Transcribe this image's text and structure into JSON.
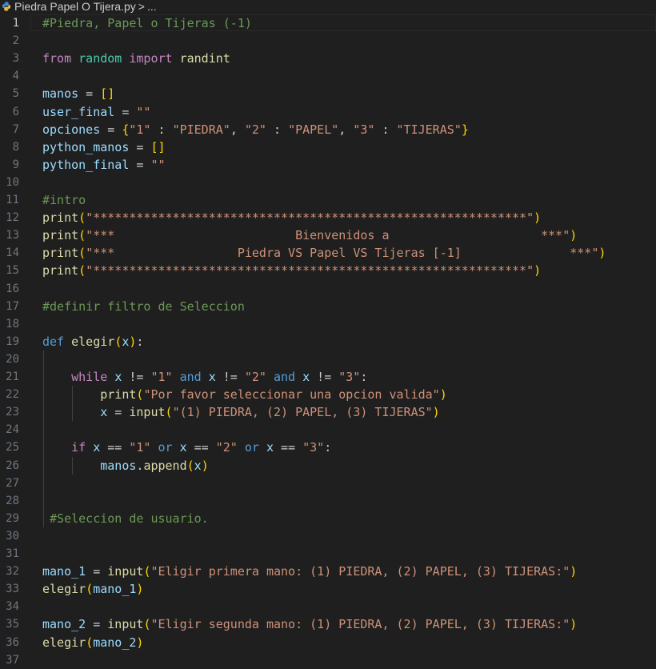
{
  "breadcrumb": {
    "file_name": "Piedra Papel O Tijera.py",
    "separator": ">",
    "ellipsis": "..."
  },
  "colors": {
    "comment": "#6a9955",
    "keyword": "#c586c0",
    "control": "#c586c0",
    "def": "#569cd6",
    "operator_word": "#569cd6",
    "string": "#ce9178",
    "variable": "#9cdcfe",
    "function": "#dcdcaa",
    "bracket1": "#ffd700",
    "bracket2": "#da70d6",
    "bracket3": "#179fff",
    "text": "#cccccc",
    "module": "#4ec9b0"
  },
  "editor": {
    "active_line": 1,
    "lines": [
      {
        "n": "1",
        "tokens": [
          [
            "#Piedra, Papel o Tijeras (-1)",
            "comment"
          ]
        ]
      },
      {
        "n": "2",
        "tokens": []
      },
      {
        "n": "3",
        "tokens": [
          [
            "from",
            "control"
          ],
          [
            " ",
            "text"
          ],
          [
            "random",
            "module"
          ],
          [
            " ",
            "text"
          ],
          [
            "import",
            "control"
          ],
          [
            " ",
            "text"
          ],
          [
            "randint",
            "func_name"
          ]
        ]
      },
      {
        "n": "4",
        "tokens": []
      },
      {
        "n": "5",
        "tokens": [
          [
            "manos",
            "variable"
          ],
          [
            " = ",
            "text"
          ],
          [
            "[]",
            "bracket1"
          ]
        ]
      },
      {
        "n": "6",
        "tokens": [
          [
            "user_final",
            "variable"
          ],
          [
            " = ",
            "text"
          ],
          [
            "\"\"",
            "string"
          ]
        ]
      },
      {
        "n": "7",
        "tokens": [
          [
            "opciones",
            "variable"
          ],
          [
            " = ",
            "text"
          ],
          [
            "{",
            "bracket1"
          ],
          [
            "\"1\"",
            "string"
          ],
          [
            " : ",
            "text"
          ],
          [
            "\"PIEDRA\"",
            "string"
          ],
          [
            ", ",
            "text"
          ],
          [
            "\"2\"",
            "string"
          ],
          [
            " : ",
            "text"
          ],
          [
            "\"PAPEL\"",
            "string"
          ],
          [
            ", ",
            "text"
          ],
          [
            "\"3\"",
            "string"
          ],
          [
            " : ",
            "text"
          ],
          [
            "\"TIJERAS\"",
            "string"
          ],
          [
            "}",
            "bracket1"
          ]
        ]
      },
      {
        "n": "8",
        "tokens": [
          [
            "python_manos",
            "variable"
          ],
          [
            " = ",
            "text"
          ],
          [
            "[]",
            "bracket1"
          ]
        ]
      },
      {
        "n": "9",
        "tokens": [
          [
            "python_final",
            "variable"
          ],
          [
            " = ",
            "text"
          ],
          [
            "\"\"",
            "string"
          ]
        ]
      },
      {
        "n": "10",
        "tokens": []
      },
      {
        "n": "11",
        "tokens": [
          [
            "#intro",
            "comment"
          ]
        ]
      },
      {
        "n": "12",
        "tokens": [
          [
            "print",
            "function"
          ],
          [
            "(",
            "bracket1"
          ],
          [
            "\"************************************************************\"",
            "string"
          ],
          [
            ")",
            "bracket1"
          ]
        ]
      },
      {
        "n": "13",
        "tokens": [
          [
            "print",
            "function"
          ],
          [
            "(",
            "bracket1"
          ],
          [
            "\"***                         Bienvenidos a                     ***\"",
            "string"
          ],
          [
            ")",
            "bracket1"
          ]
        ]
      },
      {
        "n": "14",
        "tokens": [
          [
            "print",
            "function"
          ],
          [
            "(",
            "bracket1"
          ],
          [
            "\"***                 Piedra VS Papel VS Tijeras [-1]               ***\"",
            "string"
          ],
          [
            ")",
            "bracket1"
          ]
        ]
      },
      {
        "n": "15",
        "tokens": [
          [
            "print",
            "function"
          ],
          [
            "(",
            "bracket1"
          ],
          [
            "\"************************************************************\"",
            "string"
          ],
          [
            ")",
            "bracket1"
          ]
        ]
      },
      {
        "n": "16",
        "tokens": []
      },
      {
        "n": "17",
        "tokens": [
          [
            "#definir filtro de Seleccion",
            "comment"
          ]
        ]
      },
      {
        "n": "18",
        "tokens": []
      },
      {
        "n": "19",
        "tokens": [
          [
            "def",
            "def"
          ],
          [
            " ",
            "text"
          ],
          [
            "elegir",
            "function"
          ],
          [
            "(",
            "bracket1"
          ],
          [
            "x",
            "variable"
          ],
          [
            ")",
            "bracket1"
          ],
          [
            ":",
            "text"
          ]
        ]
      },
      {
        "n": "20",
        "tokens": []
      },
      {
        "n": "21",
        "tokens": [
          [
            "    ",
            "text"
          ],
          [
            "while",
            "control"
          ],
          [
            " ",
            "text"
          ],
          [
            "x",
            "variable"
          ],
          [
            " != ",
            "text"
          ],
          [
            "\"1\"",
            "string"
          ],
          [
            " ",
            "text"
          ],
          [
            "and",
            "operator_word"
          ],
          [
            " ",
            "text"
          ],
          [
            "x",
            "variable"
          ],
          [
            " != ",
            "text"
          ],
          [
            "\"2\"",
            "string"
          ],
          [
            " ",
            "text"
          ],
          [
            "and",
            "operator_word"
          ],
          [
            " ",
            "text"
          ],
          [
            "x",
            "variable"
          ],
          [
            " != ",
            "text"
          ],
          [
            "\"3\"",
            "string"
          ],
          [
            ":",
            "text"
          ]
        ]
      },
      {
        "n": "22",
        "tokens": [
          [
            "        ",
            "text"
          ],
          [
            "print",
            "function"
          ],
          [
            "(",
            "bracket1"
          ],
          [
            "\"Por favor seleccionar una opcion valida\"",
            "string"
          ],
          [
            ")",
            "bracket1"
          ]
        ]
      },
      {
        "n": "23",
        "tokens": [
          [
            "        ",
            "text"
          ],
          [
            "x",
            "variable"
          ],
          [
            " = ",
            "text"
          ],
          [
            "input",
            "function"
          ],
          [
            "(",
            "bracket1"
          ],
          [
            "\"(1) PIEDRA, (2) PAPEL, (3) TIJERAS\"",
            "string"
          ],
          [
            ")",
            "bracket1"
          ]
        ]
      },
      {
        "n": "24",
        "tokens": []
      },
      {
        "n": "25",
        "tokens": [
          [
            "    ",
            "text"
          ],
          [
            "if",
            "control"
          ],
          [
            " ",
            "text"
          ],
          [
            "x",
            "variable"
          ],
          [
            " == ",
            "text"
          ],
          [
            "\"1\"",
            "string"
          ],
          [
            " ",
            "text"
          ],
          [
            "or",
            "operator_word"
          ],
          [
            " ",
            "text"
          ],
          [
            "x",
            "variable"
          ],
          [
            " == ",
            "text"
          ],
          [
            "\"2\"",
            "string"
          ],
          [
            " ",
            "text"
          ],
          [
            "or",
            "operator_word"
          ],
          [
            " ",
            "text"
          ],
          [
            "x",
            "variable"
          ],
          [
            " == ",
            "text"
          ],
          [
            "\"3\"",
            "string"
          ],
          [
            ":",
            "text"
          ]
        ]
      },
      {
        "n": "26",
        "tokens": [
          [
            "        ",
            "text"
          ],
          [
            "manos",
            "variable"
          ],
          [
            ".",
            "text"
          ],
          [
            "append",
            "function"
          ],
          [
            "(",
            "bracket1"
          ],
          [
            "x",
            "variable"
          ],
          [
            ")",
            "bracket1"
          ]
        ]
      },
      {
        "n": "27",
        "tokens": []
      },
      {
        "n": "28",
        "tokens": []
      },
      {
        "n": "29",
        "tokens": [
          [
            " ",
            "text"
          ],
          [
            "#Seleccion de usuario.",
            "comment"
          ]
        ]
      },
      {
        "n": "30",
        "tokens": []
      },
      {
        "n": "31",
        "tokens": []
      },
      {
        "n": "32",
        "tokens": [
          [
            "mano_1",
            "variable"
          ],
          [
            " = ",
            "text"
          ],
          [
            "input",
            "function"
          ],
          [
            "(",
            "bracket1"
          ],
          [
            "\"Eligir primera mano: (1) PIEDRA, (2) PAPEL, (3) TIJERAS:\"",
            "string"
          ],
          [
            ")",
            "bracket1"
          ]
        ]
      },
      {
        "n": "33",
        "tokens": [
          [
            "elegir",
            "function"
          ],
          [
            "(",
            "bracket1"
          ],
          [
            "mano_1",
            "variable"
          ],
          [
            ")",
            "bracket1"
          ]
        ]
      },
      {
        "n": "34",
        "tokens": []
      },
      {
        "n": "35",
        "tokens": [
          [
            "mano_2",
            "variable"
          ],
          [
            " = ",
            "text"
          ],
          [
            "input",
            "function"
          ],
          [
            "(",
            "bracket1"
          ],
          [
            "\"Eligir segunda mano: (1) PIEDRA, (2) PAPEL, (3) TIJERAS:\"",
            "string"
          ],
          [
            ")",
            "bracket1"
          ]
        ]
      },
      {
        "n": "36",
        "tokens": [
          [
            "elegir",
            "function"
          ],
          [
            "(",
            "bracket1"
          ],
          [
            "mano_2",
            "variable"
          ],
          [
            ")",
            "bracket1"
          ]
        ]
      },
      {
        "n": "37",
        "tokens": []
      }
    ]
  }
}
